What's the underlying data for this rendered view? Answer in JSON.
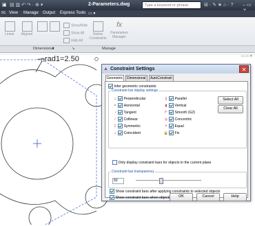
{
  "app": {
    "title": "2-Parameters.dwg",
    "search_placeholder": "Type a keyword or phrase",
    "menu": [
      "ric",
      "View",
      "Manage",
      "Output",
      "Express Tools"
    ]
  },
  "ribbon": {
    "buttons": [
      "Linear",
      "Aligned",
      "Delete Constraints",
      "Parameters Manager"
    ],
    "small_buttons": [
      "Show/Hide",
      "Show All",
      "Hide All"
    ],
    "panels": [
      "Dimensional",
      "Manage"
    ]
  },
  "drawing": {
    "dimension_label": "rad1=2.50"
  },
  "dialog": {
    "title": "Constraint Settings",
    "tabs": [
      "Geometric",
      "Dimensional",
      "AutoConstrain"
    ],
    "infer_label": "Infer geometric constraints",
    "group_display": "Constraint bar display settings",
    "left_items": [
      "Perpendicular",
      "Horizontal",
      "Tangent",
      "Collinear",
      "Symmetric",
      "Coincident"
    ],
    "right_items": [
      "Parallel",
      "Vertical",
      "Smooth (G2)",
      "Concentric",
      "Equal",
      "Fix"
    ],
    "select_all": "Select All",
    "clear_all": "Clear All",
    "only_display": "Only display constraint bars for objects in the current plane",
    "group_transparency": "Constraint bar transparency",
    "transparency_value": "50",
    "show_after": "Show constraint bars after applying constraints to selected objects",
    "show_selected": "Show constraint bars when objects are selected",
    "ok": "OK",
    "cancel": "Cancel",
    "help": "Help"
  },
  "colors": {
    "titlebar": "#2b3340",
    "ribbon": "#e3e6ea",
    "dialog_close": "#c9463d",
    "dashed_hex": "#4b6fd8"
  }
}
